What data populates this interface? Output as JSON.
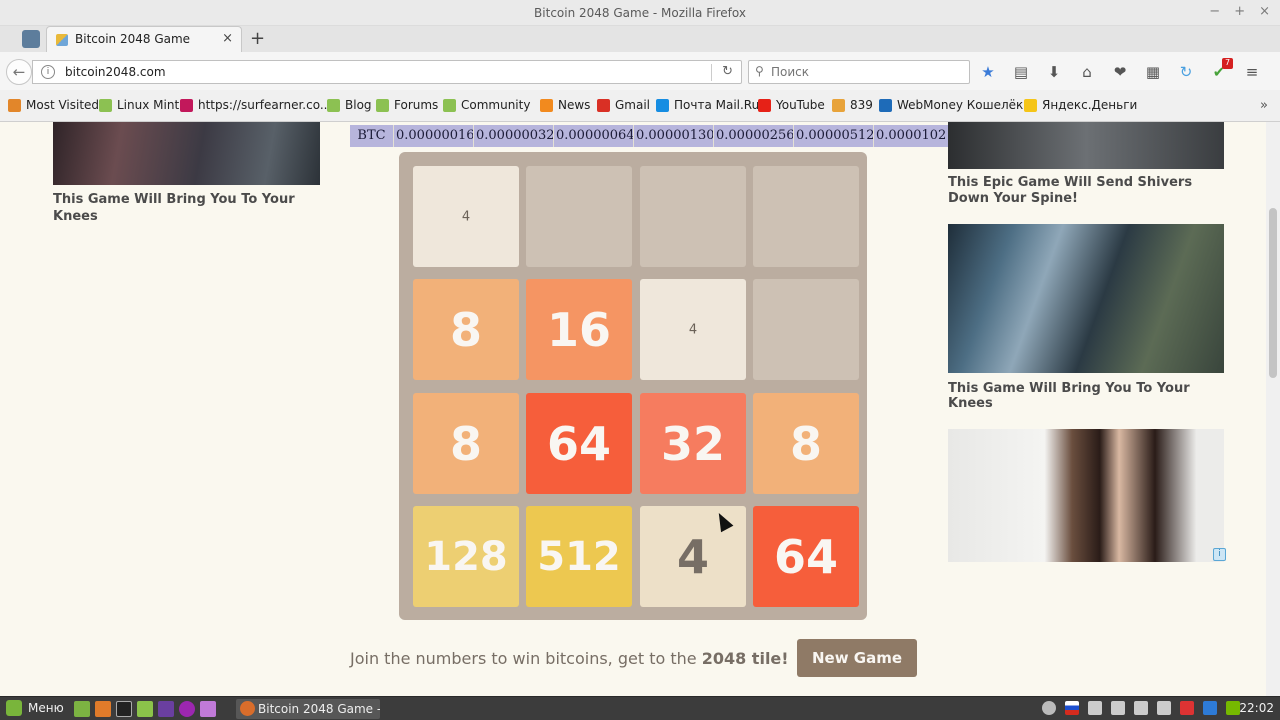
{
  "window": {
    "title": "Bitcoin 2048 Game - Mozilla Firefox",
    "minimize": "−",
    "maximize": "+",
    "close": "×"
  },
  "tabs": [
    {
      "label": "Bitcoin 2048 Game",
      "close": "×"
    }
  ],
  "new_tab": "+",
  "nav": {
    "back": "←",
    "url": "bitcoin2048.com",
    "info": "i",
    "reload": "↻",
    "search_placeholder": "Поиск",
    "search_glyph": "⚲",
    "icons": {
      "bookmark": "★",
      "reader": "▤",
      "download": "⬇",
      "home": "⌂",
      "pocket": "❤",
      "sync": "↻",
      "menu": "≡"
    },
    "addon_badge": "7"
  },
  "bookmarks": [
    {
      "label": "Most Visited",
      "color": "#e2862a"
    },
    {
      "label": "Linux Mint",
      "color": "#8cc152"
    },
    {
      "label": "https://surfearner.co...",
      "color": "#c2185b"
    },
    {
      "label": "Blog",
      "color": "#8cc152"
    },
    {
      "label": "Forums",
      "color": "#8cc152"
    },
    {
      "label": "Community",
      "color": "#8cc152"
    },
    {
      "label": "News",
      "color": "#f28a1e"
    },
    {
      "label": "Gmail",
      "color": "#d93025"
    },
    {
      "label": "Почта Mail.Ru",
      "color": "#168de2"
    },
    {
      "label": "YouTube",
      "color": "#e62117"
    },
    {
      "label": "839",
      "color": "#e8a33a"
    },
    {
      "label": "WebMoney Кошелёк »",
      "color": "#1e6bb8"
    },
    {
      "label": "Яндекс.Деньги",
      "color": "#f5c518"
    }
  ],
  "bookmarks_more": "»",
  "left_ad": {
    "caption": "This Game Will Bring You To Your Knees"
  },
  "btc_prices": {
    "label": "BTC",
    "values": [
      "0.00000016",
      "0.00000032",
      "0.00000064",
      "0.00000130",
      "0.00000256",
      "0.00000512",
      "0.0000102"
    ]
  },
  "board": {
    "rows": [
      [
        {
          "v": "4",
          "style": "ghost"
        },
        {
          "v": ""
        },
        {
          "v": ""
        },
        {
          "v": ""
        }
      ],
      [
        {
          "v": "8"
        },
        {
          "v": "16"
        },
        {
          "v": "4",
          "style": "ghost"
        },
        {
          "v": ""
        }
      ],
      [
        {
          "v": "8"
        },
        {
          "v": "64"
        },
        {
          "v": "32"
        },
        {
          "v": "8"
        }
      ],
      [
        {
          "v": "128"
        },
        {
          "v": "512"
        },
        {
          "v": "4"
        },
        {
          "v": "64"
        }
      ]
    ],
    "colors": {
      "empty": "#cdc1b4",
      "2": "#eee4da",
      "4": "#ede0c8",
      "8": "#f2b179",
      "16": "#f59563",
      "32": "#f67c5f",
      "64": "#f65e3b",
      "128": "#edcf72",
      "256": "#edcc61",
      "512": "#edc850"
    }
  },
  "footer": {
    "join_text": "Join the numbers to win bitcoins, get to the ",
    "join_bold": "2048 tile!",
    "new_game": "New Game"
  },
  "right_ads": [
    {
      "caption": "This Epic Game Will Send Shivers Down Your Spine!"
    },
    {
      "caption": "This Game Will Bring You To Your Knees"
    }
  ],
  "adchoice": "i",
  "taskbar": {
    "menu": "Меню",
    "task": "Bitcoin 2048 Game - ...",
    "clock": "22:02"
  }
}
